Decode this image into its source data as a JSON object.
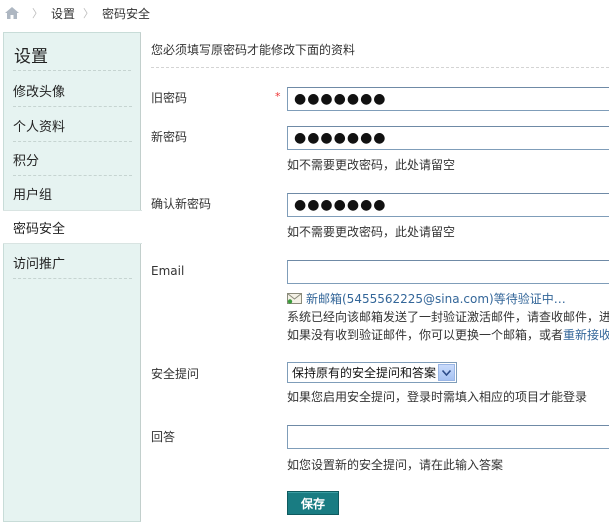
{
  "breadcrumb": {
    "items": [
      "设置",
      "密码安全"
    ]
  },
  "sidebar": {
    "title": "设置",
    "items": [
      {
        "label": "修改头像"
      },
      {
        "label": "个人资料"
      },
      {
        "label": "积分"
      },
      {
        "label": "用户组"
      },
      {
        "label": "密码安全"
      },
      {
        "label": "访问推广"
      }
    ]
  },
  "form": {
    "intro": "您必须填写原密码才能修改下面的资料",
    "old_password": {
      "label": "旧密码",
      "required_mark": "*",
      "value": "●●●●●●●"
    },
    "new_password": {
      "label": "新密码",
      "value": "●●●●●●●",
      "hint": "如不需要更改密码，此处请留空"
    },
    "confirm_password": {
      "label": "确认新密码",
      "value": "●●●●●●●",
      "hint": "如不需要更改密码，此处请留空"
    },
    "email": {
      "label": "Email",
      "value": "",
      "status": "新邮箱(5455562225@sina.com)等待验证中…",
      "line1": "系统已经向该邮箱发送了一封验证激活邮件，请查收邮件，进",
      "line2_prefix": "如果没有收到验证邮件，你可以更换一个邮箱，或者",
      "line2_link": "重新接收"
    },
    "security_question": {
      "label": "安全提问",
      "selected": "保持原有的安全提问和答案",
      "hint": "如果您启用安全提问，登录时需填入相应的项目才能登录"
    },
    "answer": {
      "label": "回答",
      "value": "",
      "hint": "如您设置新的安全提问，请在此输入答案"
    },
    "save_label": "保存"
  },
  "colors": {
    "sidebar_bg": "#e6f3f1",
    "accent_button": "#197c82",
    "link": "#336699",
    "required": "#e33333"
  },
  "icons": {
    "home": "home-icon",
    "mail": "mail-icon",
    "dropdown": "chevron-down-icon"
  }
}
